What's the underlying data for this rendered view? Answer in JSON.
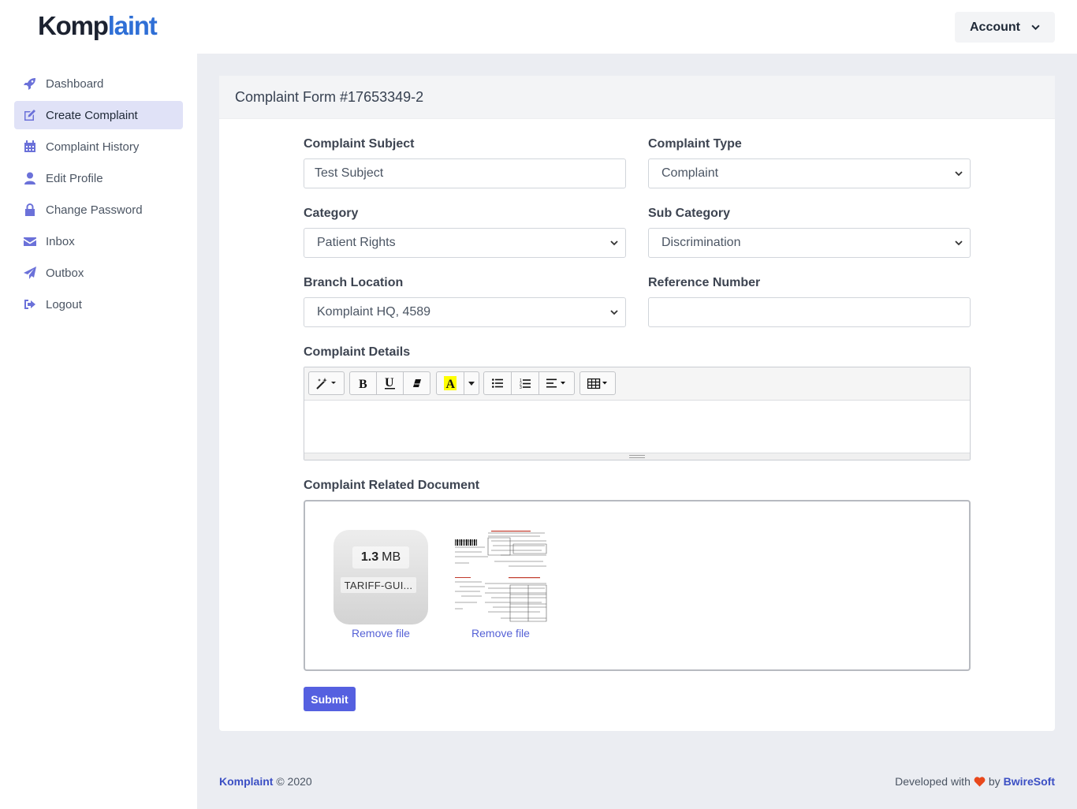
{
  "app": {
    "logo_main": "Komp",
    "logo_accent": "laint",
    "brand_color": "#2f6fd6",
    "accent_color": "#5560e0"
  },
  "header": {
    "account_label": "Account",
    "account_icon": "chevron-down-icon"
  },
  "sidebar": {
    "items": [
      {
        "label": "Dashboard",
        "icon": "rocket-icon",
        "active": false
      },
      {
        "label": "Create Complaint",
        "icon": "edit-icon",
        "active": true
      },
      {
        "label": "Complaint History",
        "icon": "calendar-icon",
        "active": false
      },
      {
        "label": "Edit Profile",
        "icon": "user-icon",
        "active": false
      },
      {
        "label": "Change Password",
        "icon": "lock-icon",
        "active": false
      },
      {
        "label": "Inbox",
        "icon": "envelope-icon",
        "active": false
      },
      {
        "label": "Outbox",
        "icon": "paper-plane-icon",
        "active": false
      },
      {
        "label": "Logout",
        "icon": "sign-out-icon",
        "active": false
      }
    ]
  },
  "form": {
    "title": "Complaint Form #17653349-2",
    "subject": {
      "label": "Complaint Subject",
      "value": "Test Subject"
    },
    "type": {
      "label": "Complaint Type",
      "value": "Complaint"
    },
    "category": {
      "label": "Category",
      "value": "Patient Rights"
    },
    "sub_category": {
      "label": "Sub Category",
      "value": "Discrimination"
    },
    "branch": {
      "label": "Branch Location",
      "value": "Komplaint HQ, 4589"
    },
    "reference": {
      "label": "Reference Number",
      "value": ""
    },
    "details": {
      "label": "Complaint Details",
      "value": ""
    },
    "documents": {
      "label": "Complaint Related Document",
      "files": [
        {
          "size_value": "1.3",
          "size_unit": "MB",
          "name": "TARIFF-GUI...",
          "remove_label": "Remove file"
        },
        {
          "remove_label": "Remove file"
        }
      ]
    },
    "submit_label": "Submit"
  },
  "footer": {
    "brand": "Komplaint",
    "copyright": "© 2020",
    "developed_with": "Developed with",
    "by": "by",
    "developer": "BwireSoft",
    "heart_color": "#e8481c"
  }
}
